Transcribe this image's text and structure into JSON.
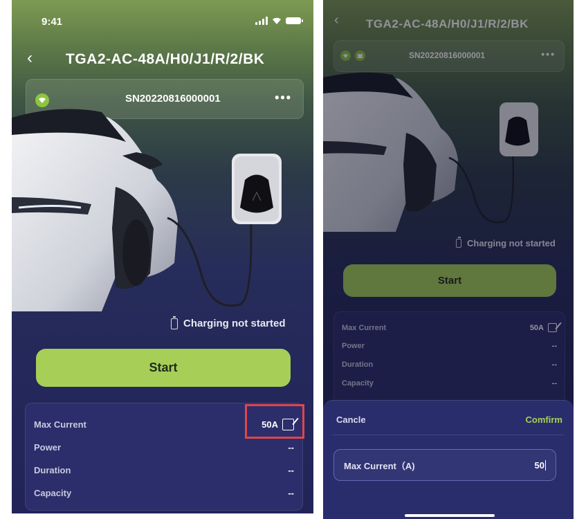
{
  "left": {
    "status_bar": {
      "time": "9:41"
    },
    "header": {
      "back_icon": "chevron-left",
      "title": "TGA2-AC-48A/H0/J1/R/2/BK"
    },
    "device": {
      "serial": "SN20220816000001",
      "more_icon": "ellipsis"
    },
    "charging_status": "Charging not started",
    "start_label": "Start",
    "info": [
      {
        "label": "Max Current",
        "value": "50A"
      },
      {
        "label": "Power",
        "value": "--"
      },
      {
        "label": "Duration",
        "value": "--"
      },
      {
        "label": "Capacity",
        "value": "--"
      }
    ]
  },
  "right": {
    "header": {
      "back_icon": "chevron-left",
      "title": "TGA2-AC-48A/H0/J1/R/2/BK"
    },
    "device": {
      "serial": "SN20220816000001",
      "more_icon": "ellipsis"
    },
    "charging_status": "Charging not started",
    "start_label": "Start",
    "info": [
      {
        "label": "Max Current",
        "value": "50A"
      },
      {
        "label": "Power",
        "value": "--"
      },
      {
        "label": "Duration",
        "value": "--"
      },
      {
        "label": "Capacity",
        "value": "--"
      }
    ],
    "sheet": {
      "cancel_label": "Cancle",
      "confirm_label": "Comfirm",
      "field_label": "Max Current（A)",
      "field_value": "50"
    }
  },
  "colors": {
    "accent": "#a7cf58",
    "highlight": "#e0454b",
    "panel": "#2b2e6a"
  }
}
